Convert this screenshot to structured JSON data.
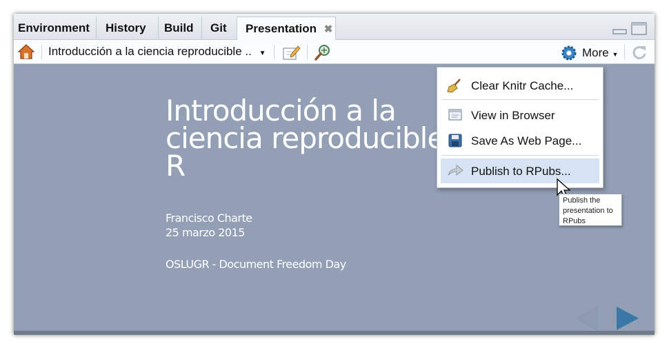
{
  "tabs": [
    {
      "label": "Environment"
    },
    {
      "label": "History"
    },
    {
      "label": "Build"
    },
    {
      "label": "Git"
    },
    {
      "label": "Presentation",
      "close": "✖"
    }
  ],
  "toolbar": {
    "presentation_title": "Introducción a la ciencia reproducible ..",
    "more_label": "More"
  },
  "slide": {
    "title_lines": [
      "Introducción a la",
      "ciencia reproducible",
      "R"
    ],
    "author": "Francisco Charte",
    "date": "25 marzo 2015",
    "event": "OSLUGR - Document Freedom Day"
  },
  "menu": {
    "items": [
      {
        "label": "Clear Knitr Cache...",
        "icon": "broom-icon"
      },
      {
        "label": "View in Browser",
        "icon": "browser-icon"
      },
      {
        "label": "Save As Web Page...",
        "icon": "save-icon"
      },
      {
        "label": "Publish to RPubs...",
        "icon": "publish-icon",
        "highlighted": true
      }
    ]
  },
  "tooltip": {
    "lines": [
      "Publish the",
      "presentation to",
      "RPubs"
    ]
  },
  "colors": {
    "slide_bg": "#929fb4",
    "accent_blue": "#3a78a8",
    "menu_highlight": "#d6e3f3"
  }
}
